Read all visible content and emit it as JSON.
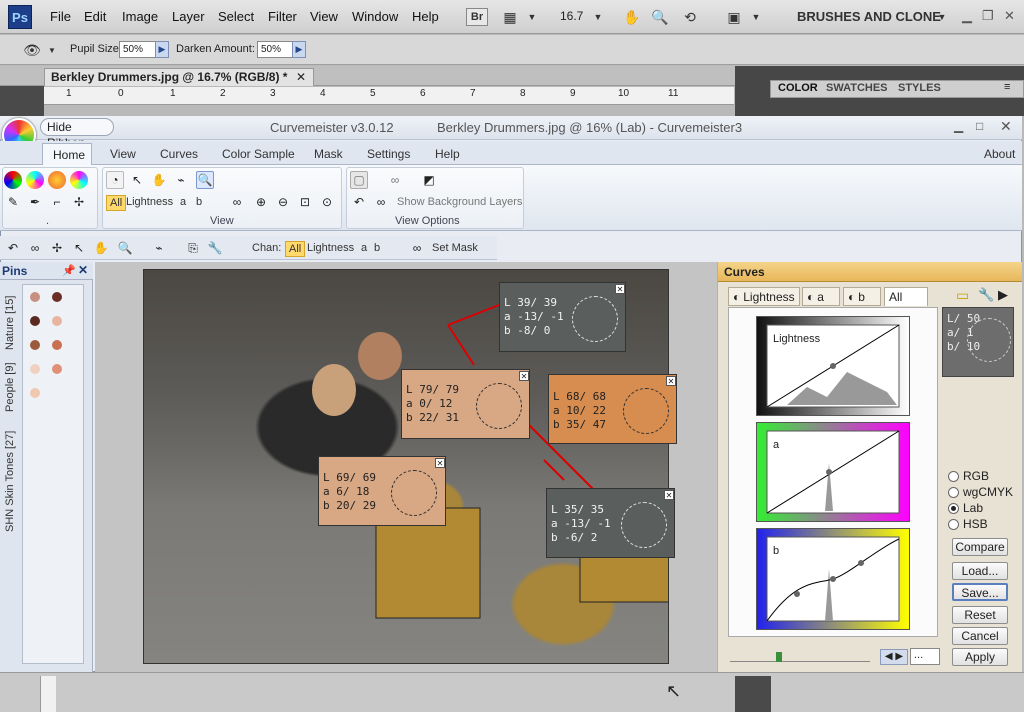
{
  "ps": {
    "logo": "Ps",
    "menu": [
      "File",
      "Edit",
      "Image",
      "Layer",
      "Select",
      "Filter",
      "View",
      "Window",
      "Help"
    ],
    "br": "Br",
    "zoom": "16.7",
    "workspace": "BRUSHES AND CLONE",
    "options": {
      "pupil_label": "Pupil Size:",
      "pupil_value": "50%",
      "darken_label": "Darken Amount:",
      "darken_value": "50%"
    },
    "doc_tab": "Berkley Drummers.jpg @ 16.7% (RGB/8) *",
    "ruler": [
      "1",
      "0",
      "1",
      "2",
      "3",
      "4",
      "5",
      "6",
      "7",
      "8",
      "9",
      "10",
      "11"
    ],
    "panel_tabs": [
      "COLOR",
      "SWATCHES",
      "STYLES"
    ]
  },
  "cm": {
    "hide_ribbon": "Hide Ribbon",
    "app_title": "Curvemeister v3.0.12",
    "doc_title": "Berkley Drummers.jpg @ 16% (Lab)  -  Curvemeister3",
    "tabs": [
      "Home",
      "View",
      "Curves",
      "Color Sample",
      "Mask",
      "Settings",
      "Help"
    ],
    "about": "About",
    "ribbon": {
      "chan_all": "All",
      "chan_lightness": "Lightness",
      "chan_a": "a",
      "chan_b": "b",
      "view_label": "View",
      "show_bg": "Show Background Layers",
      "view_options_label": "View Options",
      "dot_label": "."
    },
    "toolbar": {
      "chan_label": "Chan:",
      "all": "All",
      "lightness": "Lightness",
      "a": "a",
      "b": "b",
      "set_mask": "Set Mask"
    },
    "pins": {
      "title": "Pins",
      "tabs": [
        "Nature [15]",
        "People [9]",
        "SHN Skin Tones [27]"
      ]
    },
    "samples": [
      {
        "L": "39/ 39",
        "a": "-13/ -1",
        "b": "-8/  0"
      },
      {
        "L": "79/ 79",
        "a": "0/ 12",
        "b": "22/ 31"
      },
      {
        "L": "68/ 68",
        "a": "10/ 22",
        "b": "35/ 47"
      },
      {
        "L": "69/ 69",
        "a": "6/ 18",
        "b": "20/ 29"
      },
      {
        "L": "35/ 35",
        "a": "-13/ -1",
        "b": "-6/  2"
      }
    ],
    "curves": {
      "title": "Curves",
      "tabs": [
        "Lightness",
        "a",
        "b",
        "All"
      ],
      "readout": {
        "L": "L/ 50",
        "a": "a/  1",
        "b": "b/ 10"
      },
      "graph_labels": [
        "Lightness",
        "a",
        "b"
      ],
      "modes": [
        "RGB",
        "wgCMYK",
        "Lab",
        "HSB"
      ],
      "selected_mode": "Lab",
      "buttons": [
        "Compare",
        "Load...",
        "Save...",
        "Reset",
        "Cancel",
        "Apply"
      ],
      "zoom_field": "..."
    }
  }
}
